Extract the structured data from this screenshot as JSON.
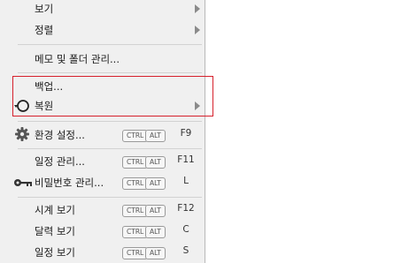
{
  "menu": {
    "view": {
      "label": "보기"
    },
    "sort": {
      "label": "정렬"
    },
    "memo_folder": {
      "label": "메모 및 폴더 관리..."
    },
    "backup": {
      "label": "백업..."
    },
    "restore": {
      "label": "복원"
    },
    "settings": {
      "label": "환경 설정...",
      "key1": "CTRL",
      "key2": "ALT",
      "key3": "F9"
    },
    "schedule": {
      "label": "일정 관리...",
      "key1": "CTRL",
      "key2": "ALT",
      "key3": "F11"
    },
    "password": {
      "label": "비밀번호 관리...",
      "key1": "CTRL",
      "key2": "ALT",
      "key3": "L"
    },
    "clock": {
      "label": "시계 보기",
      "key1": "CTRL",
      "key2": "ALT",
      "key3": "F12"
    },
    "calendar": {
      "label": "달력 보기",
      "key1": "CTRL",
      "key2": "ALT",
      "key3": "C"
    },
    "schedule_view": {
      "label": "일정 보기",
      "key1": "CTRL",
      "key2": "ALT",
      "key3": "S"
    }
  },
  "colors": {
    "highlight_box": "#d6202c",
    "menu_bg": "#f0f0f0"
  }
}
